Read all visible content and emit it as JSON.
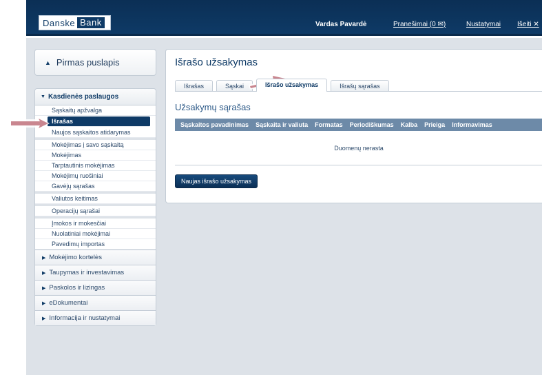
{
  "header": {
    "logo_part1": "Danske",
    "logo_part2": "Bank",
    "user_name": "Vardas Pavardė",
    "messages_link": "Pranešimai (0 ✉)",
    "settings_link": "Nustatymai",
    "logout_link": "Išeiti ✕"
  },
  "home": {
    "label": "Pirmas puslapis",
    "icon": "home-icon"
  },
  "sidebar": {
    "section_title": "Kasdienės paslaugos",
    "groups": [
      [
        "Sąskaitų apžvalga",
        "Išrašas",
        "Naujos sąskaitos atidarymas"
      ],
      [
        "Mokėjimas į savo sąskaitą",
        "Mokėjimas",
        "Tarptautinis mokėjimas",
        "Mokėjimų ruošiniai",
        "Gavėjų sąrašas"
      ],
      [
        "Valiutos keitimas"
      ],
      [
        "Operacijų sąrašai"
      ],
      [
        "Įmokos ir mokesčiai",
        "Nuolatiniai mokėjimai",
        "Pavedimų importas"
      ]
    ],
    "active_item": "Išrašas",
    "categories": [
      "Mokėjimo kortelės",
      "Taupymas ir investavimas",
      "Paskolos ir lizingas",
      "eDokumentai",
      "Informacija ir nustatymai"
    ]
  },
  "main": {
    "title": "Išrašo užsakymas",
    "tabs": [
      "Išrašas",
      "Sąskai",
      "Išrašo užsakymas",
      "Išrašų sąrašas"
    ],
    "active_tab": 2,
    "section_title": "Užsakymų sąrašas",
    "table_headers": [
      "Sąskaitos pavadinimas",
      "Sąskaita ir valiuta",
      "Formatas",
      "Periodiškumas",
      "Kalba",
      "Prieiga",
      "Informavimas"
    ],
    "empty_text": "Duomenų nerasta",
    "new_button": "Naujas išrašo užsakymas"
  },
  "colors": {
    "brand": "#0e3a66",
    "table_header": "#6d8aa8",
    "content_bg": "#dde2e8",
    "arrow": "#c9868f"
  }
}
